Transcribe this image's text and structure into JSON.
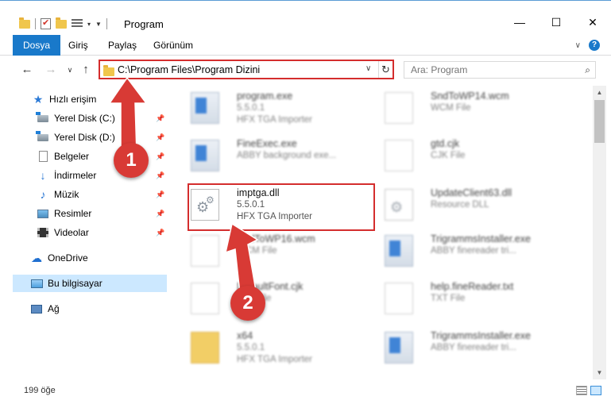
{
  "window": {
    "title": "Program",
    "minimize": "—",
    "maximize": "☐",
    "close": "✕"
  },
  "ribbon": {
    "tabs": [
      "Dosya",
      "Giriş",
      "Paylaş",
      "Görünüm"
    ],
    "expand": "∨",
    "help": "?"
  },
  "address": {
    "path": "C:\\Program Files\\Program Dizini",
    "dropdown": "∨",
    "refresh": "↻"
  },
  "search": {
    "placeholder": "Ara: Program"
  },
  "nav_buttons": {
    "back": "←",
    "forward": "→",
    "recent": "∨",
    "up": "↑"
  },
  "sidebar": {
    "items": [
      {
        "label": "Hızlı erişim",
        "icon": "star-icon"
      },
      {
        "label": "Yerel Disk (C:)",
        "icon": "drive-icon"
      },
      {
        "label": "Yerel Disk (D:)",
        "icon": "drive-icon"
      },
      {
        "label": "Belgeler",
        "icon": "document-icon"
      },
      {
        "label": "İndirmeler",
        "icon": "download-icon"
      },
      {
        "label": "Müzik",
        "icon": "music-icon"
      },
      {
        "label": "Resimler",
        "icon": "pictures-icon"
      },
      {
        "label": "Videolar",
        "icon": "video-icon"
      },
      {
        "label": "OneDrive",
        "icon": "cloud-icon"
      },
      {
        "label": "Bu bilgisayar",
        "icon": "computer-icon"
      },
      {
        "label": "Ağ",
        "icon": "network-icon"
      }
    ],
    "pin_glyph": "📌"
  },
  "files": [
    {
      "name": "program.exe",
      "line1": "5.5.0.1",
      "line2": "HFX TGA Importer",
      "type": "exe"
    },
    {
      "name": "SndToWP14.wcm",
      "line1": "WCM File",
      "line2": "",
      "type": "doc"
    },
    {
      "name": "FineExec.exe",
      "line1": "ABBY background exe...",
      "line2": "",
      "type": "exe"
    },
    {
      "name": "gtd.cjk",
      "line1": "CJK File",
      "line2": "",
      "type": "doc"
    },
    {
      "name": "imptga.dll",
      "line1": "5.5.0.1",
      "line2": "HFX TGA Importer",
      "type": "dll"
    },
    {
      "name": "UpdateClient63.dll",
      "line1": "Resource DLL",
      "line2": "",
      "type": "dll"
    },
    {
      "name": "SndToWP16.wcm",
      "line1": "WCM File",
      "line2": "",
      "type": "doc"
    },
    {
      "name": "TrigrammsInstaller.exe",
      "line1": "ABBY finereader tri...",
      "line2": "",
      "type": "exe"
    },
    {
      "name": "DefaultFont.cjk",
      "line1": "CJK File",
      "line2": "",
      "type": "doc"
    },
    {
      "name": "help.fineReader.txt",
      "line1": "TXT File",
      "line2": "",
      "type": "doc"
    },
    {
      "name": "x64",
      "line1": "5.5.0.1",
      "line2": "HFX TGA Importer",
      "type": "folder"
    },
    {
      "name": "TrigrammsInstaller.exe",
      "line1": "ABBY finereader tri...",
      "line2": "",
      "type": "exe"
    }
  ],
  "status": {
    "count": "199 öğe"
  },
  "annotations": {
    "badge1": "1",
    "badge2": "2",
    "color": "#d83a35"
  },
  "colors": {
    "accent": "#1979ca",
    "highlight_border": "#d42d2d",
    "selected_nav": "#cce8ff"
  }
}
